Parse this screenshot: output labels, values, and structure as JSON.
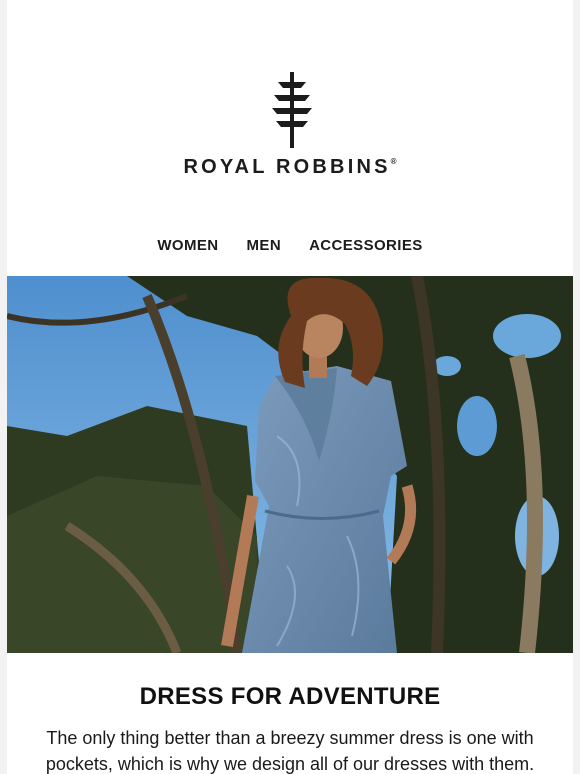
{
  "brand": {
    "name": "ROYAL ROBBINS",
    "mark": "®",
    "logo_icon": "tree-logo-icon"
  },
  "nav": {
    "items": [
      {
        "label": "WOMEN"
      },
      {
        "label": "MEN"
      },
      {
        "label": "ACCESSORIES"
      }
    ]
  },
  "hero": {
    "image_subject": "woman in a blue leaf-print shirt dress standing among trees"
  },
  "content": {
    "headline": "DRESS FOR ADVENTURE",
    "body": "The only thing better than a breezy summer dress is one with pockets, which is why we design all of our dresses with them."
  },
  "colors": {
    "text": "#1c1c1c",
    "sky": "#5b9bd5",
    "dress": "#6b8aab",
    "foliage": "#2b3a1e"
  }
}
